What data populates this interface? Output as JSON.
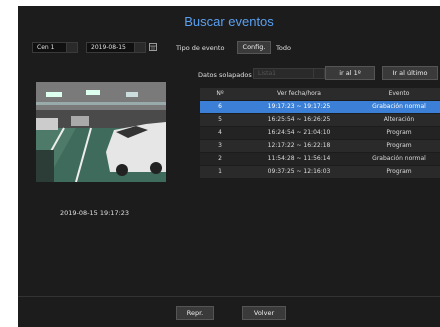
{
  "window": {
    "title": "Buscar eventos"
  },
  "toolbar": {
    "channel": "Cen 1",
    "date": "2019-08-15",
    "event_type_label": "Tipo de evento",
    "config_label": "Config.",
    "event_type_value": "Todo",
    "overlap_label": "Datos solapados",
    "overlap_value": "Lista1",
    "first_label": "ir al 1º",
    "last_label": "Ir al último"
  },
  "preview": {
    "timestamp": "2019-08-15 19:17:23"
  },
  "table": {
    "headers": [
      "Nº",
      "Ver fecha/hora",
      "Evento"
    ],
    "rows": [
      {
        "n": "6",
        "time": "19:17:23 ~ 19:17:25",
        "event": "Grabación normal"
      },
      {
        "n": "5",
        "time": "16:25:54 ~ 16:26:25",
        "event": "Alteración"
      },
      {
        "n": "4",
        "time": "16:24:54 ~ 21:04:10",
        "event": "Program"
      },
      {
        "n": "3",
        "time": "12:17:22 ~ 16:22:18",
        "event": "Program"
      },
      {
        "n": "2",
        "time": "11:54:28 ~ 11:56:14",
        "event": "Grabación normal"
      },
      {
        "n": "1",
        "time": "09:37:25 ~ 12:16:03",
        "event": "Program"
      }
    ]
  },
  "footer": {
    "play_label": "Repr.",
    "back_label": "Volver"
  },
  "colors": {
    "accent": "#3b7fd6",
    "title": "#5aa0f0",
    "background": "#1c1c1c"
  }
}
